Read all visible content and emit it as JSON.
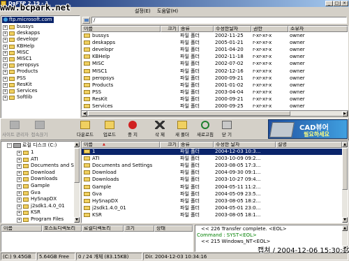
{
  "window": {
    "title": "DaFTP 2.19 - 1",
    "watermark": "www.bcpark.net"
  },
  "menu": {
    "items": [
      "설정(E)",
      "도움말(H)"
    ]
  },
  "remote": {
    "path": "/",
    "tree_root": "ftp.microsoft.com",
    "tree": [
      "bussys",
      "deskapps",
      "developr",
      "KBHelp",
      "MISC",
      "MISC1",
      "peropsys",
      "Products",
      "PSS",
      "ResKit",
      "Services",
      "Softlib"
    ],
    "columns": [
      "이름",
      "크기",
      "종류",
      "수정한날자",
      "권한",
      "소유자"
    ],
    "rows": [
      [
        "bussys",
        "",
        "파일 폴더",
        "2002-11-25",
        "r-xr-xr-x",
        "owner"
      ],
      [
        "deskapps",
        "",
        "파일 폴더",
        "2005-01-21",
        "r-xr-xr-x",
        "owner"
      ],
      [
        "developr",
        "",
        "파일 폴더",
        "2001-04-20",
        "r-xr-xr-x",
        "owner"
      ],
      [
        "KBHelp",
        "",
        "파일 폴더",
        "2002-11-18",
        "r-xr-xr-x",
        "owner"
      ],
      [
        "MISC",
        "",
        "파일 폴더",
        "2002-07-02",
        "r-xr-xr-x",
        "owner"
      ],
      [
        "MISC1",
        "",
        "파일 폴더",
        "2002-12-16",
        "r-xr-xr-x",
        "owner"
      ],
      [
        "peropsys",
        "",
        "파일 폴더",
        "2000-09-21",
        "r-xr-xr-x",
        "owner"
      ],
      [
        "Products",
        "",
        "파일 폴더",
        "2001-01-02",
        "r-xr-xr-x",
        "owner"
      ],
      [
        "PSS",
        "",
        "파일 폴더",
        "2003-04-04",
        "r-xr-xr-x",
        "owner"
      ],
      [
        "ResKit",
        "",
        "파일 폴더",
        "2000-09-21",
        "r-xr-xr-x",
        "owner"
      ],
      [
        "Services",
        "",
        "파일 폴더",
        "2000-09-25",
        "r-xr-xr-x",
        "owner"
      ]
    ]
  },
  "toolbar": {
    "buttons": [
      {
        "label": "사이트 관리자",
        "icon": "site-manager-icon"
      },
      {
        "label": "접속끊기",
        "icon": "disconnect-icon"
      },
      {
        "label": "다운로드",
        "icon": "download-icon"
      },
      {
        "label": "업로드",
        "icon": "upload-icon"
      },
      {
        "label": "중 지",
        "icon": "stop-icon"
      },
      {
        "label": "삭 제",
        "icon": "delete-icon"
      },
      {
        "label": "새 폴더",
        "icon": "new-folder-icon"
      },
      {
        "label": "새로고침",
        "icon": "refresh-icon"
      },
      {
        "label": "닫 기",
        "icon": "close-icon"
      }
    ],
    "banner_main": "CAD뷰어",
    "banner_sub": "필요하세요"
  },
  "local": {
    "drive_label": "로컬 디스크 (C:)",
    "tree": [
      "1",
      "ATI",
      "Documents and Se",
      "Download",
      "Downloads",
      "Gample",
      "Gva",
      "HySnapDX",
      "j2sdk1.4.0_01",
      "KSR",
      "Program Files"
    ],
    "columns": [
      "이름",
      "크기",
      "종류",
      "수정한 날자",
      "설명"
    ],
    "rows": [
      [
        "1",
        "",
        "파일 폴더",
        "2004-12-03 10:3..."
      ],
      [
        "ATI",
        "",
        "파일 폴더",
        "2003-10-09 09:2..."
      ],
      [
        "Documents and Settings",
        "",
        "파일 폴더",
        "2003-08-05 17:3..."
      ],
      [
        "Download",
        "",
        "파일 폴더",
        "2004-09-30 09:1..."
      ],
      [
        "Downloads",
        "",
        "파일 폴더",
        "2003-10-27 09:4..."
      ],
      [
        "Gample",
        "",
        "파일 폴더",
        "2004-05-11 11:2..."
      ],
      [
        "Gva",
        "",
        "파일 폴더",
        "2004-05-09 23:5..."
      ],
      [
        "HySnapDX",
        "",
        "파일 폴더",
        "2003-08-05 18:2..."
      ],
      [
        "j2sdk1.4.0_01",
        "",
        "파일 폴더",
        "2004-05-01 23:0..."
      ],
      [
        "KSR",
        "",
        "파일 폴더",
        "2003-08-05 18:1..."
      ]
    ]
  },
  "queue": {
    "columns": [
      "이름",
      "호스트디렉토리",
      "로컬디렉토리",
      "크기",
      "상태"
    ]
  },
  "log": [
    {
      "text": "<< 226 Transfer complete. <EOL>",
      "color": "#000000"
    },
    {
      "text": "Command : SYST<EOL>",
      "color": "#008000"
    },
    {
      "text": "<< 215 Windows_NT<EOL>",
      "color": "#000000"
    }
  ],
  "capture_stamp": "캡쳐 / 2004-12-06 15:30:12",
  "status": [
    "(C:) 9.45GB",
    "5.64GB Free",
    "0 / 24 개체 (83.15KB)",
    "Dir. 2004-12-03 10:34:16"
  ]
}
